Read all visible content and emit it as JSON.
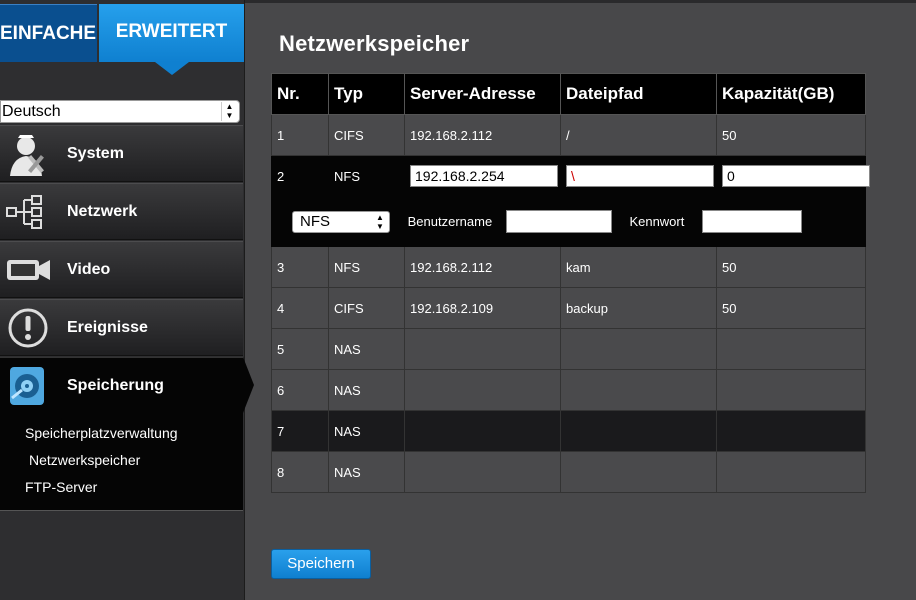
{
  "tabs": {
    "basic": "EINFACHE",
    "advanced": "ERWEITERT"
  },
  "language": {
    "selected": "Deutsch"
  },
  "menu": [
    {
      "label": "System",
      "icon": "system-tools-icon"
    },
    {
      "label": "Netzwerk",
      "icon": "network-tree-icon"
    },
    {
      "label": "Video",
      "icon": "video-camera-icon"
    },
    {
      "label": "Ereignisse",
      "icon": "alert-icon"
    },
    {
      "label": "Speicherung",
      "icon": "storage-disk-icon"
    }
  ],
  "submenu": [
    "Speicherplatzverwaltung",
    "Netzwerkspeicher",
    "FTP-Server"
  ],
  "page": {
    "title": "Netzwerkspeicher"
  },
  "table": {
    "headers": [
      "Nr.",
      "Typ",
      "Server-Adresse",
      "Dateipfad",
      "Kapazität(GB)"
    ],
    "rows": [
      {
        "nr": "1",
        "typ": "CIFS",
        "server": "192.168.2.112",
        "path": "/",
        "cap": "50"
      },
      {
        "nr": "2",
        "typ": "NFS",
        "server": "192.168.2.254",
        "path": "\\",
        "cap": "0"
      },
      {
        "nr": "3",
        "typ": "NFS",
        "server": "192.168.2.112",
        "path": "kam",
        "cap": "50"
      },
      {
        "nr": "4",
        "typ": "CIFS",
        "server": "192.168.2.109",
        "path": "backup",
        "cap": "50"
      },
      {
        "nr": "5",
        "typ": "NAS",
        "server": "",
        "path": "",
        "cap": ""
      },
      {
        "nr": "6",
        "typ": "NAS",
        "server": "",
        "path": "",
        "cap": ""
      },
      {
        "nr": "7",
        "typ": "NAS",
        "server": "",
        "path": "",
        "cap": ""
      },
      {
        "nr": "8",
        "typ": "NAS",
        "server": "",
        "path": "",
        "cap": ""
      }
    ]
  },
  "edit_options": {
    "protocol": "NFS",
    "username_label": "Benutzername",
    "password_label": "Kennwort"
  },
  "actions": {
    "save": "Speichern"
  },
  "colors": {
    "accent": "#1a8fde",
    "sidebar": "#2e2e30",
    "background": "#48484a"
  }
}
